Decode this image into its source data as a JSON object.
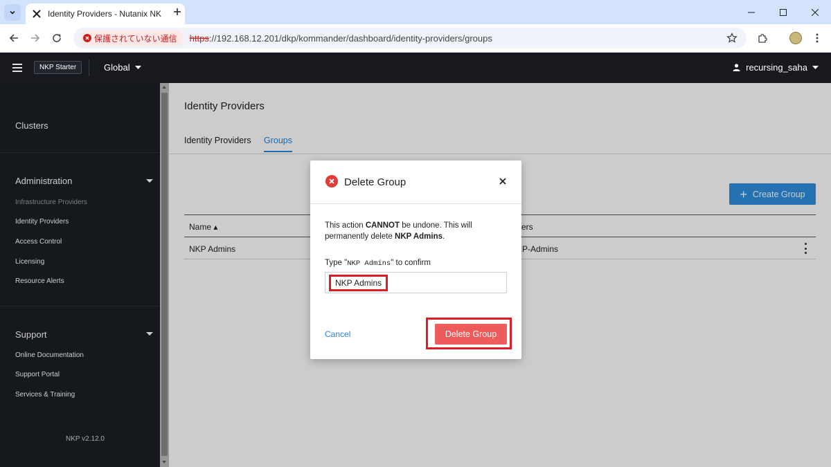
{
  "browser": {
    "tab_title": "Identity Providers - Nutanix NK",
    "security_label": "保護されていない通信",
    "url_scheme": "https",
    "url_rest": "://192.168.12.201/dkp/kommander/dashboard/identity-providers/groups"
  },
  "header": {
    "brand": "NKP Starter",
    "scope": "Global",
    "user": "recursing_saha"
  },
  "sidebar": {
    "clusters": "Clusters",
    "administration": {
      "title": "Administration",
      "items": [
        "Infrastructure Providers",
        "Identity Providers",
        "Access Control",
        "Licensing",
        "Resource Alerts"
      ]
    },
    "support": {
      "title": "Support",
      "items": [
        "Online Documentation",
        "Support Portal",
        "Services & Training"
      ]
    },
    "version": "NKP v2.12.0"
  },
  "main": {
    "title": "Identity Providers",
    "tabs": [
      "Identity Providers",
      "Groups"
    ],
    "active_tab": "Groups",
    "create_button": "Create Group",
    "table": {
      "headers": [
        "Name ▴",
        "ers"
      ],
      "rows": [
        [
          "NKP Admins",
          "KP-Admins"
        ]
      ]
    }
  },
  "modal": {
    "title": "Delete Group",
    "message_prefix": "This action ",
    "message_strong": "CANNOT",
    "message_mid": " be undone. This will permanently delete ",
    "message_target": "NKP Admins",
    "message_suffix": ".",
    "confirm_prefix": "Type \"",
    "confirm_code": "NKP Admins",
    "confirm_suffix": "\" to confirm",
    "input_value": "NKP Admins",
    "cancel": "Cancel",
    "delete": "Delete Group"
  },
  "colors": {
    "accent": "#2f8ede",
    "danger": "#ee5b5b",
    "highlight": "#e01b23",
    "header_bg": "#17191e",
    "sidebar_bg": "#1b1e24"
  }
}
